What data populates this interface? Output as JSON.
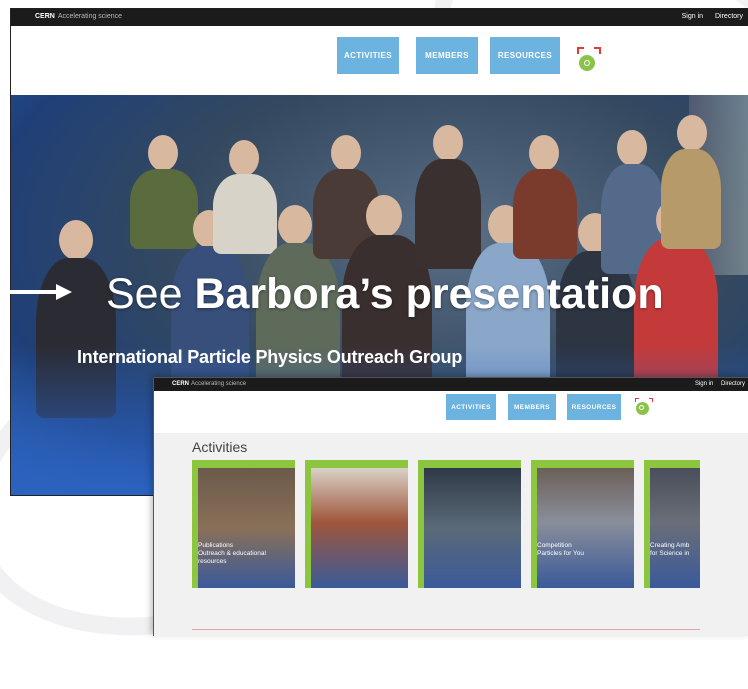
{
  "back_window": {
    "topbar": {
      "brand": "CERN",
      "tagline": "Accelerating science",
      "sign_in": "Sign in",
      "directory": "Directory"
    },
    "nav": [
      "ACTIVITIES",
      "MEMBERS",
      "RESOURCES"
    ],
    "hero_text_normal": "See ",
    "hero_text_bold": "Barbora’s presentation",
    "hero_subtitle": "International Particle Physics Outreach Group"
  },
  "front_window": {
    "topbar": {
      "brand": "CERN",
      "tagline": "Accelerating science",
      "sign_in": "Sign in",
      "directory": "Directory"
    },
    "nav": [
      "ACTIVITIES",
      "MEMBERS",
      "RESOURCES"
    ],
    "section_title": "Activities",
    "cards": [
      {
        "line1": "Publications",
        "line2": "Outreach & educational resources",
        "theme": "#6b5a4a"
      },
      {
        "line1": "",
        "line2": "",
        "theme": "#a0563c"
      },
      {
        "line1": "",
        "line2": "",
        "theme": "#3a4a5e"
      },
      {
        "line1": "Competition",
        "line2": "Particles for You",
        "theme": "#5a5048"
      },
      {
        "line1": "Creating Amb",
        "line2": "for Science in",
        "theme": "#4a4e5a"
      }
    ]
  },
  "colors": {
    "accent_blue": "#6cb3e0",
    "accent_green": "#8cc63f",
    "topbar": "#1b1b1b"
  },
  "icons": [
    "search-icon",
    "arrow-right-icon"
  ]
}
